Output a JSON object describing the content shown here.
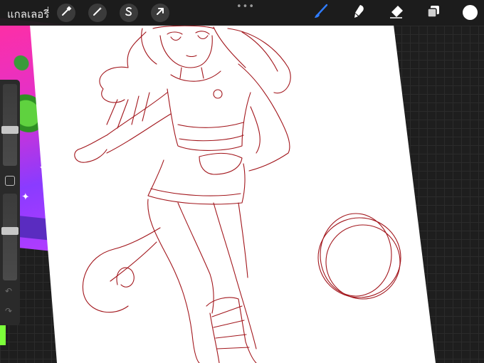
{
  "app": "Procreate",
  "topbar": {
    "gallery_label": "แกลเลอรี่",
    "left_tools": [
      {
        "name": "actions",
        "icon": "wrench-icon"
      },
      {
        "name": "adjustments",
        "icon": "magic-wand-icon"
      },
      {
        "name": "selection",
        "icon": "selection-s-icon"
      },
      {
        "name": "transform",
        "icon": "arrow-cursor-icon"
      }
    ],
    "more_label": "•••",
    "right_tools": [
      {
        "name": "brush",
        "icon": "brush-icon",
        "active": true
      },
      {
        "name": "smudge",
        "icon": "smudge-icon",
        "active": false
      },
      {
        "name": "eraser",
        "icon": "eraser-icon",
        "active": false
      },
      {
        "name": "layers",
        "icon": "layers-icon",
        "active": false
      }
    ],
    "current_color": "#ffffff",
    "active_tool_color": "#2f7cff"
  },
  "sidebar": {
    "brush_size_level": 0.43,
    "opacity_level": 0.58,
    "modify_button": "square-modify-icon",
    "undo_icon": "undo-icon",
    "redo_icon": "redo-icon"
  },
  "canvas": {
    "sketch_color": "#a2161c",
    "background": "#ffffff"
  }
}
